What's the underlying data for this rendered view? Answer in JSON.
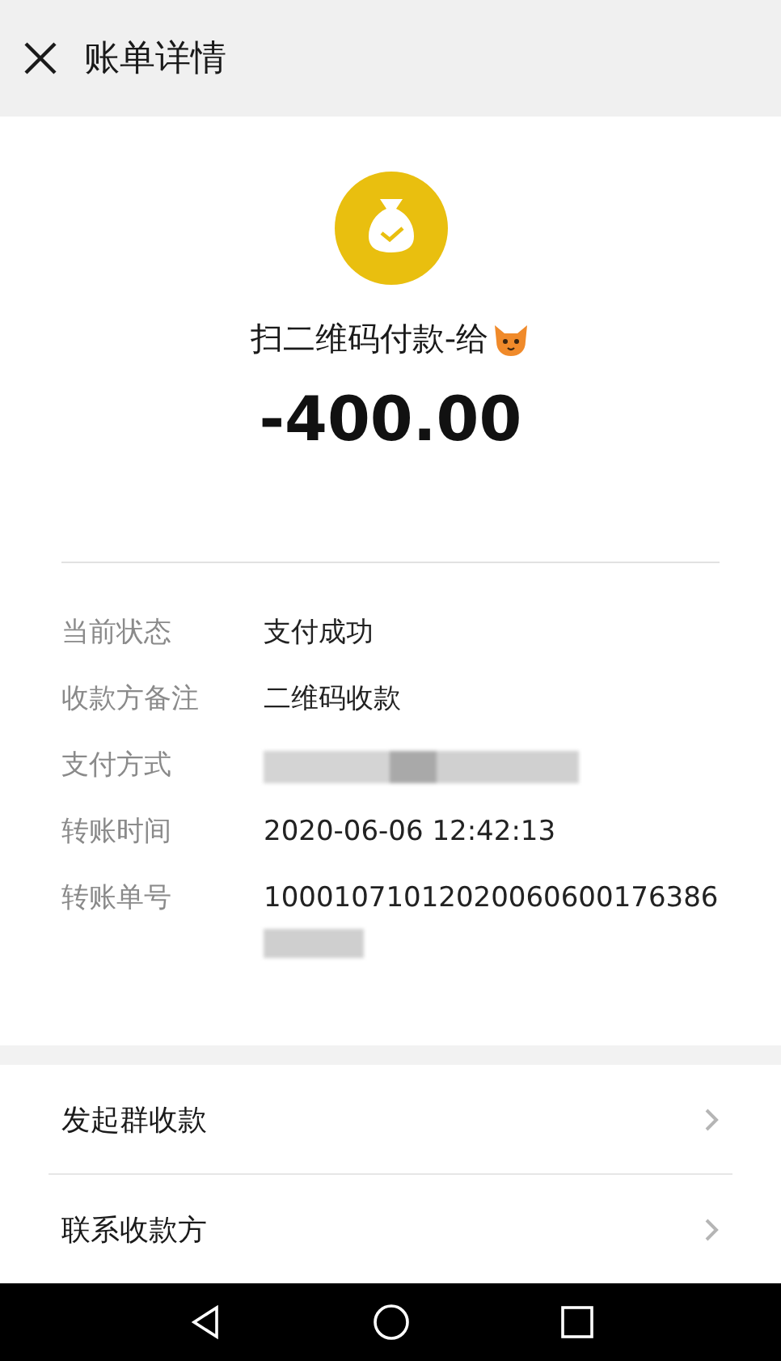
{
  "header": {
    "title": "账单详情"
  },
  "summary": {
    "title": "扫二维码付款-给",
    "amount": "-400.00"
  },
  "details": [
    {
      "label": "当前状态",
      "value": "支付成功",
      "redacted": false
    },
    {
      "label": "收款方备注",
      "value": "二维码收款",
      "redacted": false
    },
    {
      "label": "支付方式",
      "redacted": true
    },
    {
      "label": "转账时间",
      "value": "2020-06-06 12:42:13",
      "redacted": false
    },
    {
      "label": "转账单号",
      "value": "10001071012020060600176386",
      "redacted": true
    }
  ],
  "actions": [
    {
      "label": "发起群收款"
    },
    {
      "label": "联系收款方"
    }
  ]
}
